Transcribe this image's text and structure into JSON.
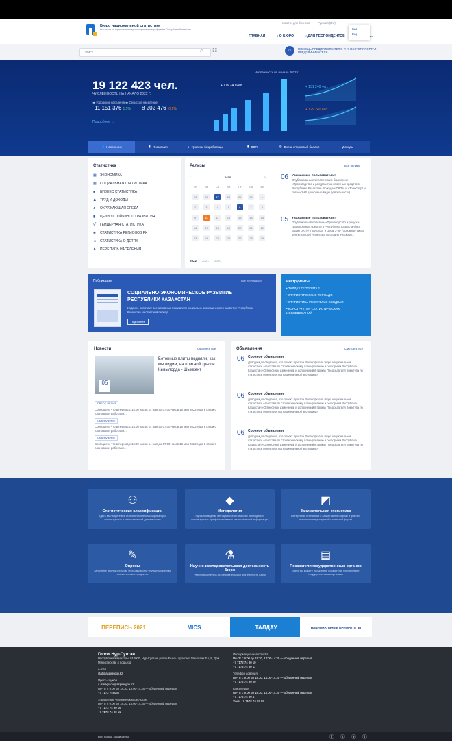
{
  "header": {
    "brand_line1": "Бюро национальной статистики",
    "brand_line2": "Агентства по стратегическому планированию и реформам Республики Казахстан",
    "links": [
      "Новости для бизнеса",
      "Русский (RU)"
    ],
    "nav": [
      "ГЛАВНАЯ",
      "О БЮРО",
      "ДЛЯ РЕСПОНДЕНТОВ",
      "ИНФО..."
    ],
    "lang_options": [
      "Kaz",
      "Eng"
    ]
  },
  "search": {
    "placeholder": "Поиск",
    "mayor_text": "ПОМОЩЬ ПРЕДПРИНИМАТЕЛЮ И ИНВЕСТОРУ ПОРТАЛ ПРЕДПРИНИМАТЕЛЯ"
  },
  "hero": {
    "population": "19 122 423 чел.",
    "population_label": "ЧИСЛЕННОСТЬ НА НАЧАЛО 2022 Г.",
    "urban_label": "Городское население",
    "urban_value": "11 151 376",
    "urban_pct": "1,5%",
    "rural_label": "Сельское население",
    "rural_value": "8 202 476",
    "rural_pct": "-0,1%",
    "more": "Подробнее",
    "chart_title": "Численность на начало 2022 г.",
    "chart_callout": "+ 116 240 чел.",
    "growth1": "+ 131 240 чел.",
    "growth2": "+ 129 240 чел."
  },
  "tabs": [
    "Население",
    "Инфляция",
    "Уровень безработицы",
    "ВВП",
    "Внешнеторговый баланс",
    "Доходы"
  ],
  "statistics": {
    "title": "Статистика",
    "items": [
      "ЭКОНОМИКА",
      "СОЦИАЛЬНАЯ СТАТИСТИКА",
      "БИЗНЕС СТАТИСТИКА",
      "ТРУД И ДОХОДЫ",
      "ОКРУЖАЮЩАЯ СРЕДА",
      "ЦЕЛИ УСТОЙЧИВОГО РАЗВИТИЯ",
      "ГЕНДЕРНАЯ СТАТИСТИКА",
      "СТАТИСТИКА РЕГИОНОВ РК",
      "СТАТИСТИКА О ДЕТЯХ",
      "ПЕРЕПИСЬ НАСЕЛЕНИЯ"
    ]
  },
  "releases": {
    "title": "Релизы",
    "all": "Все релизы",
    "month": "мая",
    "weekdays": [
      "Пн",
      "Вт",
      "Ср",
      "Чт",
      "Пт",
      "Сб",
      "Вс"
    ],
    "years": [
      "2022",
      "2021",
      "2020"
    ],
    "items": [
      {
        "day": "06",
        "title": "Уважаемые пользователи!",
        "text": "Опубликованы статистические бюллетени «Производство и ресурсы транспортных средств в Республике Казахстан (по кодам ОКП)» и «Транспорт и связь» 2-КР (основные виды деятельности)."
      },
      {
        "day": "05",
        "title": "Уважаемые пользователи!",
        "text": "Опубликован бюллетень «Производство и ресурсы транспортных средств в Республике Казахстан (по кодам ОКП)» Транспорт и связь 2-КР (основные виды деятельности) Агентства по стратегическому..."
      }
    ]
  },
  "publication": {
    "label": "Публикации",
    "all": "Все публикации",
    "title": "СОЦИАЛЬНО-ЭКОНОМИЧЕСКОЕ РАЗВИТИЕ РЕСПУБЛИКИ КАЗАХСТАН",
    "desc": "Издание включает все основные показатели социально-экономического развития Республики Казахстан за отчетный период.",
    "btn": "Подробнее"
  },
  "tools": {
    "title": "Инструменты",
    "items": [
      "• ТАЛДАУ ГЕОПОРТАЛ",
      "• СТАТИСТИЧЕСКИЕ ТОРНАДО",
      "• СТАТИСТИКА РЕСПУБЛИК СВОДНАЯ",
      "• КОНСТРУКТОР СТАТИСТИЧЕСКИХ ИССЛЕДОВАНИЙ"
    ]
  },
  "news": {
    "title": "Новости",
    "all": "Смотреть все",
    "headline": "Бетонные плиты подняли, как мы видим, на плитной трассе Кызылорда - Шымкент",
    "date_day": "05",
    "items": [
      {
        "tag": "ПРЕСС-РЕЛИЗ",
        "text": "Сообщаем, что в период с 15:00 часов 14 мая до 07:00 часов 16 мая 2022 года в связи с плановыми работами..."
      },
      {
        "tag": "ОБЪЯВЛЕНИЕ",
        "text": "Сообщаем, что в период с 15:00 часов 14 мая до 07:00 часов 16 мая 2022 года в связи с плановыми работами..."
      },
      {
        "tag": "ОБЪЯВЛЕНИЕ",
        "text": "Сообщаем, что в период с 15:00 часов 14 мая до 07:00 часов 16 мая 2022 года в связи с плановыми работами..."
      }
    ]
  },
  "ads": {
    "title": "Объявления",
    "all": "Смотреть все",
    "items": [
      {
        "day": "06",
        "title": "Срочное объявление",
        "text": "Доводим до сведения, что проект приказа Руководителя Бюро национальной статистики Агентства по стратегическому планированию и реформам Республики Казахстан «О внесении изменений и дополнений в приказ Председателя Комитета по статистике Министерства национальной экономики»"
      },
      {
        "day": "06",
        "title": "Срочное объявление",
        "text": "Доводим до сведения, что проект приказа Руководителя Бюро национальной статистики Агентства по стратегическому планированию и реформам Республики Казахстан «О внесении изменений и дополнений в приказ Председателя Комитета по статистике Министерства национальной экономики»"
      },
      {
        "day": "06",
        "title": "Срочное объявление",
        "text": "Доводим до сведения, что проект приказа Руководителя Бюро национальной статистики Агентства по стратегическому планированию и реформам Республики Казахстан «О внесении изменений и дополнений в приказ Председателя Комитета по статистике Министерства национальной экономики»"
      }
    ]
  },
  "tiles": [
    {
      "icon": "people-icon",
      "title": "Статистические классификации",
      "desc": "Здесь вы найдете все статистические классификаторы, используемые в статистической деятельности"
    },
    {
      "icon": "book-icon",
      "title": "Методология",
      "desc": "Здесь приведены методики статистических наблюдений, используемые при формировании статистической информации"
    },
    {
      "icon": "chart-icon",
      "title": "Занимательная статистика",
      "desc": "Интересная статистика о Казахстане в цифрах и фактах, изложенная в доступной и понятной форме"
    },
    {
      "icon": "poll-icon",
      "title": "Опросы",
      "desc": "Заполните анкеты опросов, чтобы мы могли улучшить качество статистических продуктов"
    },
    {
      "icon": "research-icon",
      "title": "Научно-исследовательская деятельность Бюро",
      "desc": "Результаты научно-исследовательской деятельности Бюро"
    },
    {
      "icon": "indicators-icon",
      "title": "Показатели государственных органов",
      "desc": "Здесь вы можете посмотреть показатели, публикуемые государственными органами"
    }
  ],
  "partners": [
    "ПЕРЕПИСЬ 2021",
    "MICS",
    "ТАЛДАУ",
    "НАЦИОНАЛЬНЫЕ ПРИОРИТЕТЫ"
  ],
  "footer": {
    "city": "Город Нур-Султан",
    "address": "Республика Казахстан, 010000, Нур-Султан, район Есиль, проспект Мангилик Ел, 8, Дом Министерств, 4 подъезд",
    "email_label": "e-mail",
    "email": "stat@aspire.gov.kz",
    "press_label": "Пресс-служба",
    "press_email": "a.ismagulov@aspire.gov.kz",
    "press_hours": "Пн-Пт с 9:00 до 18:30, 13:00-14:30 — обеденный перерыв",
    "press_phone": "+7 7172 749060",
    "hr_label": "Управление человеческих ресурсов",
    "hr_hours": "Пн-Пт с 9:00 до 18:30, 13:00-14:30 — обеденный перерыв",
    "hr_phone1": "+7 7172 74 90 16",
    "hr_phone2": "+7 7172 74 90 11",
    "col2": [
      {
        "label": "Информационная служба",
        "hours": "Пн-Пт с 9:00 до 18:30, 13:00-14:30 — обеденный перерыв",
        "phones": [
          "+7 7172 74 90 10",
          "+7 7172 74 90 11"
        ]
      },
      {
        "label": "Телефон доверия",
        "hours": "Пн-Пт с 9:00 до 18:30, 13:00-14:30 — обеденный перерыв",
        "phones": [
          "+7 7172 74 90 00"
        ]
      },
      {
        "label": "Канцелярия",
        "hours": "Пн-Пт с 9:00 до 18:30, 13:00-14:30 — обеденный перерыв",
        "phones": [
          "+7 7172 74 90 47",
          "Факс: +7 7172 74 90 00"
        ]
      }
    ],
    "copyright": "Все права защищены."
  },
  "colors": {
    "navy": "#0b2a72",
    "accent": "#2a55a8",
    "orange": "#f07b2b",
    "tool_blue": "#1b7fd4",
    "footer": "#2a2f36"
  }
}
